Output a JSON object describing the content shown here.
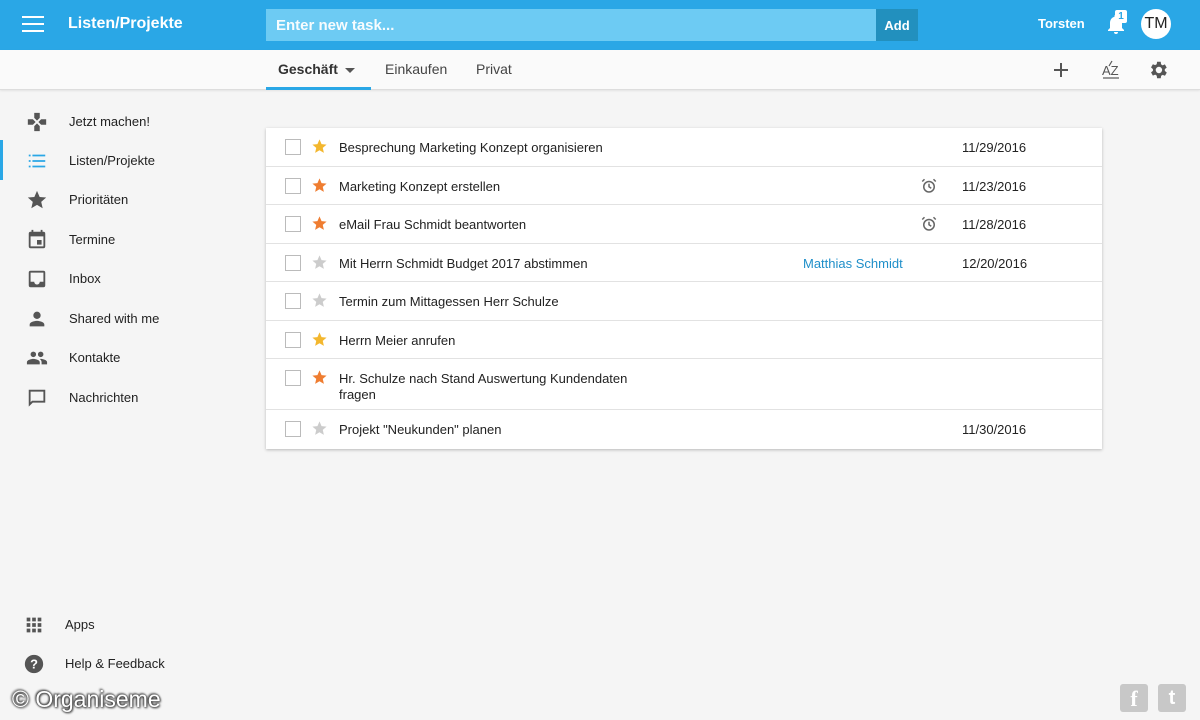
{
  "header": {
    "app_title": "Listen/Projekte",
    "task_input_placeholder": "Enter new task...",
    "add_label": "Add",
    "user_name": "Torsten",
    "notification_count": "1",
    "avatar_initials": "TM",
    "accent_color": "#2aa7e6"
  },
  "tabs": [
    {
      "label": "Geschäft",
      "active": true
    },
    {
      "label": "Einkaufen",
      "active": false
    },
    {
      "label": "Privat",
      "active": false
    }
  ],
  "toolbar_icons": [
    "plus-icon",
    "sort-az-icon",
    "gear-icon"
  ],
  "sidebar": {
    "items": [
      {
        "label": "Jetzt machen!",
        "icon": "gamepad-icon"
      },
      {
        "label": "Listen/Projekte",
        "icon": "list-icon",
        "active": true
      },
      {
        "label": "Prioritäten",
        "icon": "star-icon"
      },
      {
        "label": "Termine",
        "icon": "calendar-icon"
      },
      {
        "label": "Inbox",
        "icon": "inbox-icon"
      },
      {
        "label": "Shared with me",
        "icon": "person-icon"
      },
      {
        "label": "Kontakte",
        "icon": "people-icon"
      },
      {
        "label": "Nachrichten",
        "icon": "chat-icon"
      }
    ],
    "bottom_items": [
      {
        "label": "Apps",
        "icon": "apps-grid-icon"
      },
      {
        "label": "Help & Feedback",
        "icon": "help-icon"
      }
    ]
  },
  "tasks": [
    {
      "title": "Besprechung Marketing Konzept organisieren",
      "star": "yellow",
      "alarm": false,
      "assignee": "",
      "due": "11/29/2016"
    },
    {
      "title": "Marketing Konzept erstellen",
      "star": "orange",
      "alarm": true,
      "assignee": "",
      "due": "11/23/2016"
    },
    {
      "title": "eMail Frau Schmidt beantworten",
      "star": "orange",
      "alarm": true,
      "assignee": "",
      "due": "11/28/2016"
    },
    {
      "title": "Mit Herrn Schmidt Budget 2017 abstimmen",
      "star": "gray",
      "alarm": false,
      "assignee": "Matthias Schmidt",
      "due": "12/20/2016"
    },
    {
      "title": "Termin zum Mittagessen Herr Schulze",
      "star": "gray",
      "alarm": false,
      "assignee": "",
      "due": ""
    },
    {
      "title": "Herrn Meier anrufen",
      "star": "yellow",
      "alarm": false,
      "assignee": "",
      "due": ""
    },
    {
      "title": "Hr. Schulze nach Stand Auswertung Kundendaten fragen",
      "star": "orange",
      "alarm": false,
      "assignee": "",
      "due": ""
    },
    {
      "title": "Projekt \"Neukunden\" planen",
      "star": "gray",
      "alarm": false,
      "assignee": "",
      "due": "11/30/2016"
    }
  ],
  "star_colors": {
    "yellow": "#f3b72e",
    "orange": "#ef7d31",
    "gray": "#cccccc"
  },
  "watermark": "© Organiseme",
  "social_icons": [
    "facebook-icon",
    "twitter-icon"
  ]
}
